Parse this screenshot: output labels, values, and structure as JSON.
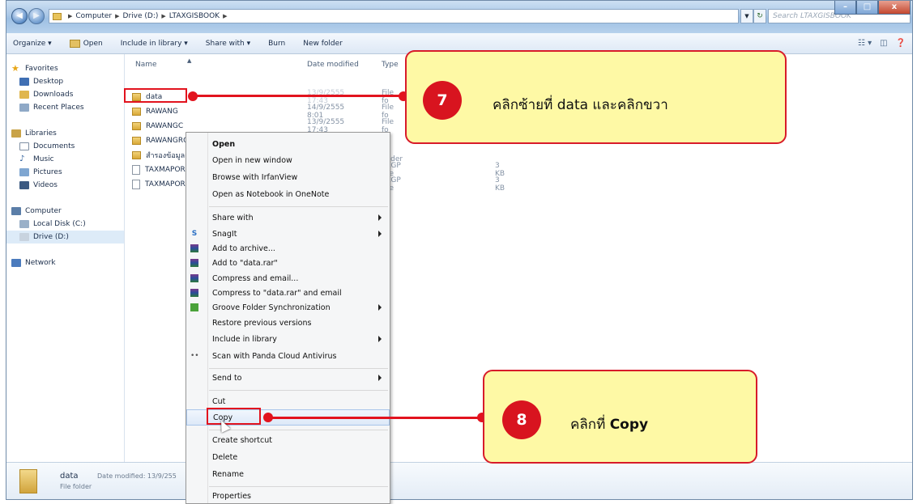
{
  "window": {
    "breadcrumbs": [
      "Computer",
      "Drive (D:)",
      "LTAXGISBOOK"
    ],
    "search_placeholder": "Search LTAXGISBOOK",
    "buttons": {
      "minimize": "–",
      "maximize": "□",
      "close": "x"
    }
  },
  "toolbar": {
    "organize": "Organize ▾",
    "open": "Open",
    "include_in_library": "Include in library ▾",
    "share_with": "Share with ▾",
    "burn": "Burn",
    "new_folder": "New folder"
  },
  "navpane": {
    "favorites": "Favorites",
    "desktop": "Desktop",
    "downloads": "Downloads",
    "recent_places": "Recent Places",
    "libraries": "Libraries",
    "documents": "Documents",
    "music": "Music",
    "pictures": "Pictures",
    "videos": "Videos",
    "computer": "Computer",
    "local_disk": "Local Disk (C:)",
    "drive_d": "Drive (D:)",
    "network": "Network"
  },
  "filelist": {
    "columns": {
      "name": "Name",
      "date": "Date modified",
      "type": "Type"
    },
    "rows": [
      {
        "name": "data",
        "date": "13/9/2555 17:43",
        "type": "File fo",
        "size": ""
      },
      {
        "name": "RAWANG",
        "date": "14/9/2555 8:01",
        "type": "File fo",
        "size": ""
      },
      {
        "name": "RAWANGC",
        "date": "13/9/2555 17:43",
        "type": "File fo",
        "size": ""
      },
      {
        "name": "RAWANGRO",
        "date": "",
        "type": "le fol",
        "size": ""
      },
      {
        "name": "สำรองข้อมูลแ",
        "date": "",
        "type": "le folder",
        "size": ""
      },
      {
        "name": "TAXMAPOR",
        "date": "",
        "type": "TKGP File",
        "size": "3 KB"
      },
      {
        "name": "TAXMAPOR",
        "date": "",
        "type": "TKGP File",
        "size": "3 KB"
      }
    ]
  },
  "statusbar": {
    "name": "data",
    "meta": "Date modified: 13/9/255",
    "type": "File folder"
  },
  "context_menu": {
    "open": "Open",
    "open_new_window": "Open in new window",
    "browse_irfanview": "Browse with IrfanView",
    "open_onenote": "Open as Notebook in OneNote",
    "share_with": "Share with",
    "snagit": "SnagIt",
    "add_archive": "Add to archive...",
    "add_data_rar": "Add to \"data.rar\"",
    "compress_email": "Compress and email...",
    "compress_data_rar_email": "Compress to \"data.rar\" and email",
    "groove": "Groove Folder Synchronization",
    "restore": "Restore previous versions",
    "include_library": "Include in library",
    "panda": "Scan with Panda Cloud Antivirus",
    "send_to": "Send to",
    "cut": "Cut",
    "copy": "Copy",
    "create_shortcut": "Create shortcut",
    "delete": "Delete",
    "rename": "Rename",
    "properties": "Properties"
  },
  "callouts": {
    "step7": {
      "number": "7",
      "text": "คลิกซ้ายที่  data และคลิกขวา"
    },
    "step8": {
      "number": "8",
      "text_prefix": "คลิกที่ ",
      "text_bold": "Copy"
    }
  },
  "colors": {
    "accent_red": "#e2131e",
    "callout_fill": "#fef9a5"
  }
}
